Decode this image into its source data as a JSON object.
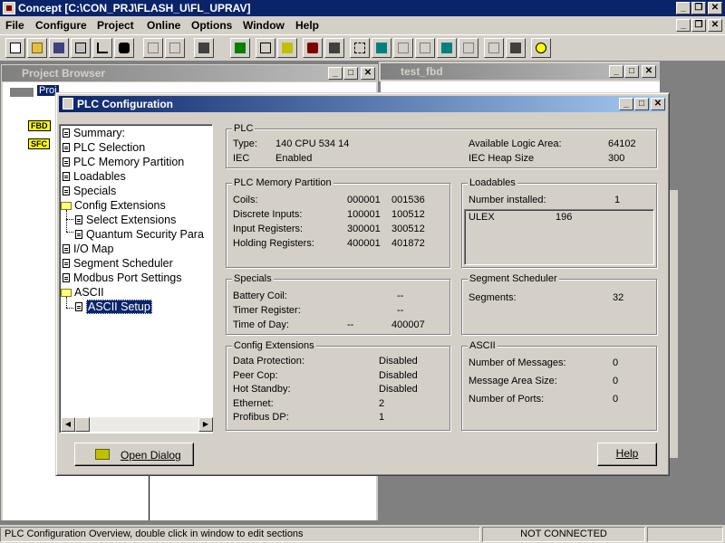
{
  "app": {
    "title": "Concept [C:\\CON_PRJ\\FLASH_U\\FL_UPRAV]",
    "menu": [
      "File",
      "Configure",
      "Project",
      "Online",
      "Options",
      "Window",
      "Help"
    ],
    "title_buttons": [
      "_",
      "❐",
      "✕"
    ]
  },
  "project_browser": {
    "title": "Project Browser",
    "root_label": "Proj",
    "nodes": [
      "FBD",
      "SFC"
    ]
  },
  "test_window": {
    "title": "test_fbd"
  },
  "dialog": {
    "title": "PLC Configuration",
    "tree": [
      {
        "label": "Summary:"
      },
      {
        "label": "PLC Selection"
      },
      {
        "label": "PLC Memory Partition"
      },
      {
        "label": "Loadables"
      },
      {
        "label": "Specials"
      },
      {
        "label": "Config Extensions"
      },
      {
        "label": "Select Extensions"
      },
      {
        "label": "Quantum Security Para"
      },
      {
        "label": "I/O Map"
      },
      {
        "label": "Segment Scheduler"
      },
      {
        "label": "Modbus Port Settings"
      },
      {
        "label": "ASCII"
      },
      {
        "label": "ASCII Setup"
      }
    ],
    "plc": {
      "title": "PLC",
      "type_label": "Type:",
      "type_value": "140 CPU 534 14",
      "iec_label": "IEC",
      "iec_value": "Enabled",
      "logic_label": "Available Logic Area:",
      "logic_value": "64102",
      "heap_label": "IEC Heap Size",
      "heap_value": "300"
    },
    "memory": {
      "title": "PLC Memory Partition",
      "rows": [
        {
          "label": "Coils:",
          "start": "000001",
          "end": "001536"
        },
        {
          "label": "Discrete Inputs:",
          "start": "100001",
          "end": "100512"
        },
        {
          "label": "Input Registers:",
          "start": "300001",
          "end": "300512"
        },
        {
          "label": "Holding Registers:",
          "start": "400001",
          "end": "401872"
        }
      ]
    },
    "loadables": {
      "title": "Loadables",
      "installed_label": "Number installed:",
      "installed_value": "1",
      "items": [
        {
          "name": "ULEX",
          "value": "196"
        }
      ]
    },
    "specials": {
      "title": "Specials",
      "battery_label": "Battery Coil:",
      "battery_value": "--",
      "timer_label": "Timer Register:",
      "timer_value": "--",
      "tod_label": "Time of Day:",
      "tod_value1": "--",
      "tod_value2": "400007"
    },
    "segment": {
      "title": "Segment Scheduler",
      "segments_label": "Segments:",
      "segments_value": "32"
    },
    "config_ext": {
      "title": "Config Extensions",
      "rows": [
        {
          "label": "Data Protection:",
          "value": "Disabled"
        },
        {
          "label": "Peer Cop:",
          "value": "Disabled"
        },
        {
          "label": "Hot Standby:",
          "value": "Disabled"
        },
        {
          "label": "Ethernet:",
          "value": "2"
        },
        {
          "label": "Profibus DP:",
          "value": "1"
        }
      ]
    },
    "ascii": {
      "title": "ASCII",
      "rows": [
        {
          "label": "Number of Messages:",
          "value": "0"
        },
        {
          "label": "Message Area Size:",
          "value": "0"
        },
        {
          "label": "Number of Ports:",
          "value": "0"
        }
      ]
    },
    "open_dialog_label": "Open Dialog",
    "help_label": "Help"
  },
  "status": {
    "message": "PLC Configuration Overview, double click in window to edit sections",
    "connection": "NOT CONNECTED"
  }
}
